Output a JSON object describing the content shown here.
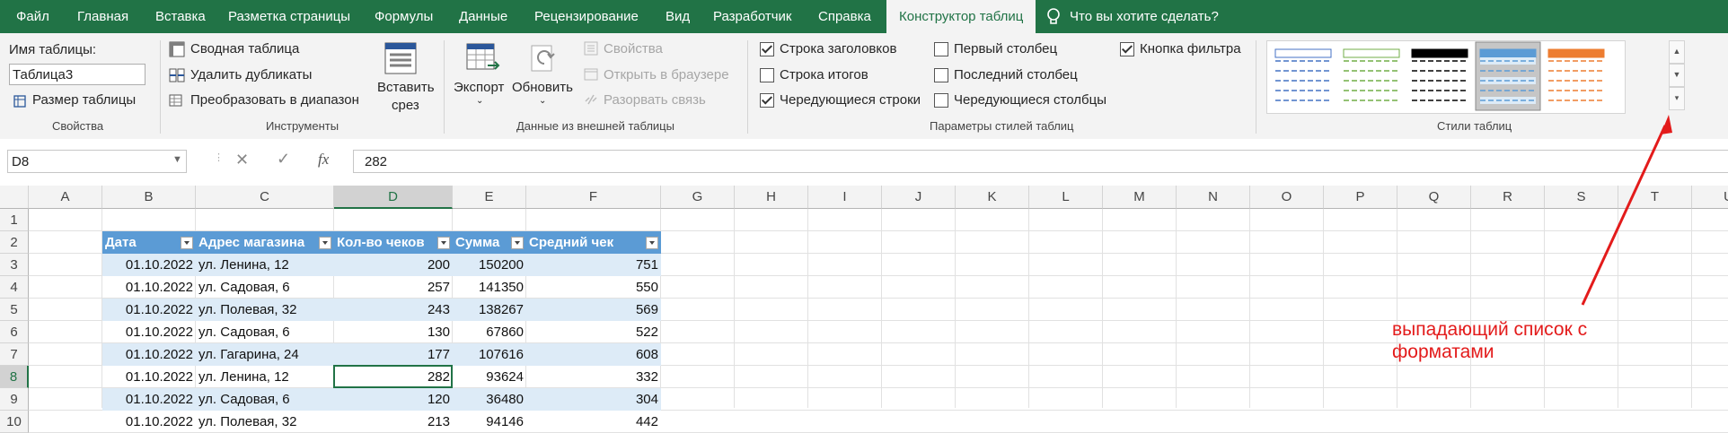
{
  "menu": {
    "tabs": [
      "Файл",
      "Главная",
      "Вставка",
      "Разметка страницы",
      "Формулы",
      "Данные",
      "Рецензирование",
      "Вид",
      "Разработчик",
      "Справка",
      "Конструктор таблиц"
    ],
    "tell_me": "Что вы хотите сделать?"
  },
  "ribbon": {
    "properties": {
      "name_label": "Имя таблицы:",
      "name_value": "Таблица3",
      "resize": "Размер таблицы",
      "group": "Свойства"
    },
    "tools": {
      "pivot": "Сводная таблица",
      "remove_dupes": "Удалить дубликаты",
      "convert": "Преобразовать в диапазон",
      "slicer_line1": "Вставить",
      "slicer_line2": "срез",
      "group": "Инструменты"
    },
    "external": {
      "export": "Экспорт",
      "refresh": "Обновить",
      "properties": "Свойства",
      "open_browser": "Открыть в браузере",
      "unlink": "Разорвать связь",
      "group": "Данные из внешней таблицы"
    },
    "style_options": {
      "header_row": "Строка заголовков",
      "total_row": "Строка итогов",
      "banded_rows": "Чередующиеся строки",
      "first_column": "Первый столбец",
      "last_column": "Последний столбец",
      "banded_columns": "Чередующиеся столбцы",
      "filter_button": "Кнопка фильтра",
      "group": "Параметры стилей таблиц"
    },
    "styles": {
      "group": "Стили таблиц",
      "swatch_colors": [
        "#4472c4",
        "#70ad47",
        "#000000",
        "#5b9bd5",
        "#ed7d31"
      ]
    }
  },
  "formula_bar": {
    "name_box": "D8",
    "fx": "fx",
    "value": "282"
  },
  "sheet": {
    "columns": [
      "A",
      "B",
      "C",
      "D",
      "E",
      "F",
      "G",
      "H",
      "I",
      "J",
      "K",
      "L",
      "M",
      "N",
      "O",
      "P",
      "Q",
      "R",
      "S",
      "T",
      "U"
    ],
    "rows": [
      "1",
      "2",
      "3",
      "4",
      "5",
      "6",
      "7",
      "8",
      "9",
      "10"
    ],
    "table": {
      "headers": [
        "Дата",
        "Адрес магазина",
        "Кол-во чеков",
        "Сумма",
        "Средний чек"
      ],
      "rows": [
        [
          "01.10.2022",
          "ул. Ленина, 12",
          "200",
          "150200",
          "751"
        ],
        [
          "01.10.2022",
          "ул. Садовая, 6",
          "257",
          "141350",
          "550"
        ],
        [
          "01.10.2022",
          "ул. Полевая, 32",
          "243",
          "138267",
          "569"
        ],
        [
          "01.10.2022",
          "ул. Садовая, 6",
          "130",
          "67860",
          "522"
        ],
        [
          "01.10.2022",
          "ул. Гагарина, 24",
          "177",
          "107616",
          "608"
        ],
        [
          "01.10.2022",
          "ул. Ленина, 12",
          "282",
          "93624",
          "332"
        ],
        [
          "01.10.2022",
          "ул. Садовая, 6",
          "120",
          "36480",
          "304"
        ],
        [
          "01.10.2022",
          "ул. Полевая, 32",
          "213",
          "94146",
          "442"
        ]
      ]
    }
  },
  "annotation": {
    "text": "выпадающий список с форматами",
    "color": "#e31b1b"
  },
  "colors": {
    "accent": "#217346",
    "table_header": "#5b9bd5",
    "table_band": "#ddebf7"
  }
}
